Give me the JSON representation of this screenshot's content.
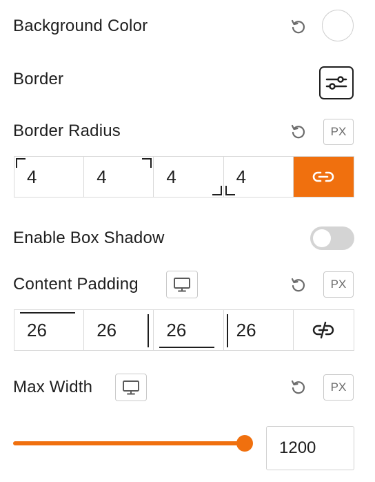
{
  "background_color": {
    "label": "Background Color",
    "reset_icon": "reset-icon",
    "swatch_color": "#ffffff"
  },
  "border": {
    "label": "Border",
    "settings_icon": "sliders-icon"
  },
  "border_radius": {
    "label": "Border Radius",
    "reset_icon": "reset-icon",
    "unit": "PX",
    "values": [
      "4",
      "4",
      "4",
      "4"
    ],
    "link_icon": "link-icon",
    "linked": true,
    "accent_color": "#f0700e"
  },
  "box_shadow": {
    "label": "Enable Box Shadow",
    "enabled": false
  },
  "content_padding": {
    "label": "Content Padding",
    "device_icon": "desktop-icon",
    "reset_icon": "reset-icon",
    "unit": "PX",
    "values": [
      "26",
      "26",
      "26",
      "26"
    ],
    "link_icon": "unlink-icon",
    "linked": false
  },
  "max_width": {
    "label": "Max Width",
    "device_icon": "desktop-icon",
    "reset_icon": "reset-icon",
    "unit": "PX",
    "value": "1200",
    "slider_fraction": 1.0
  }
}
